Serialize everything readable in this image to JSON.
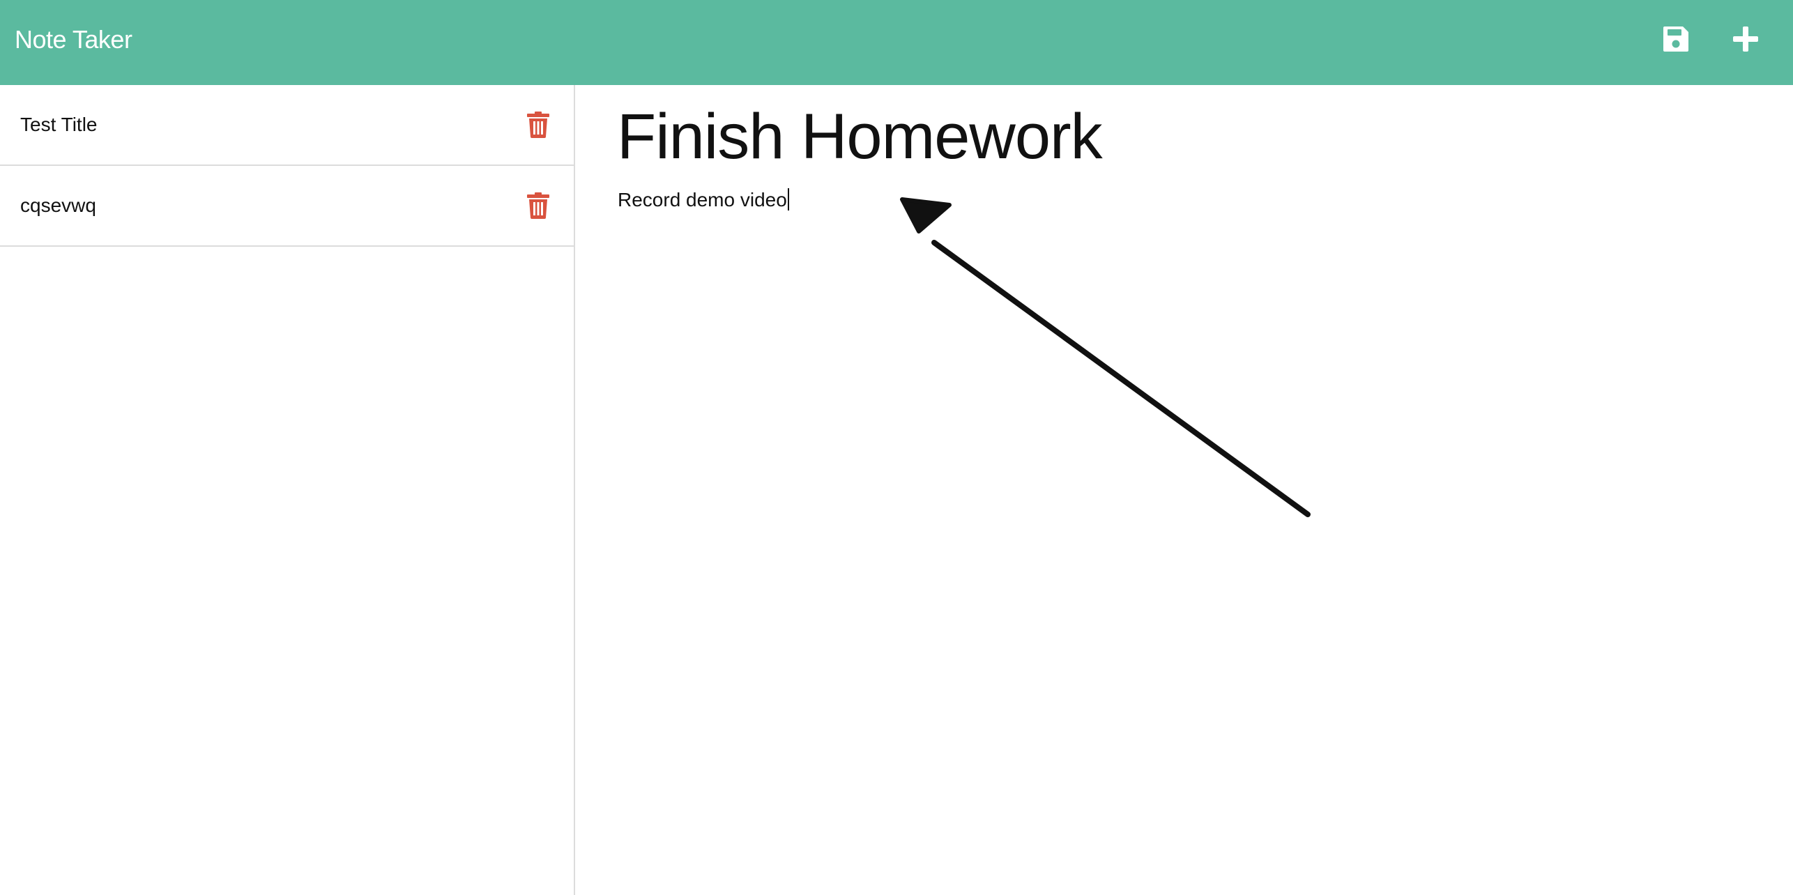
{
  "app": {
    "title": "Note Taker",
    "accent_color": "#5bba9f",
    "delete_color": "#d9533f"
  },
  "toolbar": {
    "save_icon": "floppy-disk-icon",
    "new_icon": "plus-icon"
  },
  "notes": [
    {
      "title": "Test Title",
      "icon": "trash-icon"
    },
    {
      "title": "cqsevwq",
      "icon": "trash-icon"
    }
  ],
  "active_note": {
    "title": "Finish Homework",
    "text": "Record demo video"
  },
  "annotation": {
    "icon": "hand-drawn-arrow-icon"
  }
}
